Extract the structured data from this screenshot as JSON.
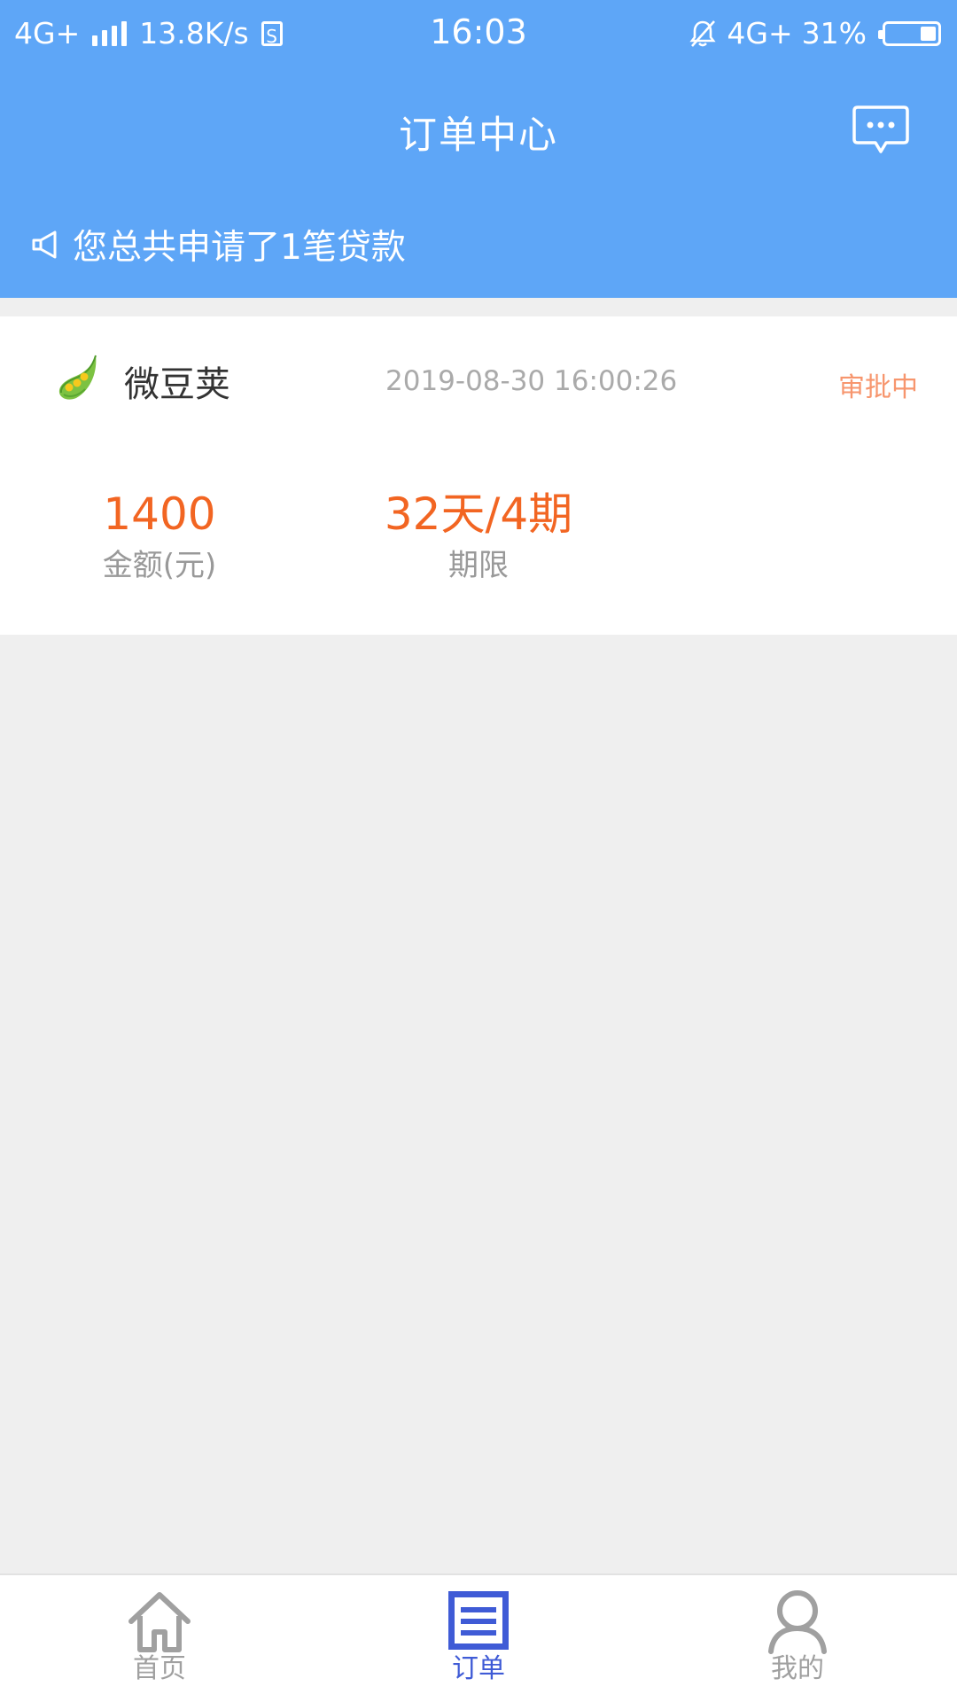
{
  "colors": {
    "header_bg": "#5ea6f7",
    "accent_orange": "#f26522",
    "status_pending": "#f7966e",
    "tab_active": "#3f5bd6",
    "tab_inactive": "#a0a0a0"
  },
  "status_bar": {
    "network_left": "4G+",
    "speed": "13.8K/s",
    "sim_icon_glyph": "S",
    "time": "16:03",
    "network_right": "4G+",
    "battery_percent_label": "31%",
    "battery_level": 0.31
  },
  "header": {
    "title": "订单中心",
    "chat_icon": "chat-bubble-icon"
  },
  "notice": {
    "icon": "megaphone-icon",
    "text": "您总共申请了1笔贷款"
  },
  "order": {
    "logo_icon": "pea-pod-logo",
    "name": "微豆荚",
    "datetime": "2019-08-30 16:00:26",
    "status": "审批中",
    "amount_value": "1400",
    "amount_label": "金额(元)",
    "term_value": "32天/4期",
    "term_label": "期限"
  },
  "tabs": [
    {
      "label": "首页",
      "icon": "home-icon",
      "active": false
    },
    {
      "label": "订单",
      "icon": "order-list-icon",
      "active": true
    },
    {
      "label": "我的",
      "icon": "user-icon",
      "active": false
    }
  ]
}
